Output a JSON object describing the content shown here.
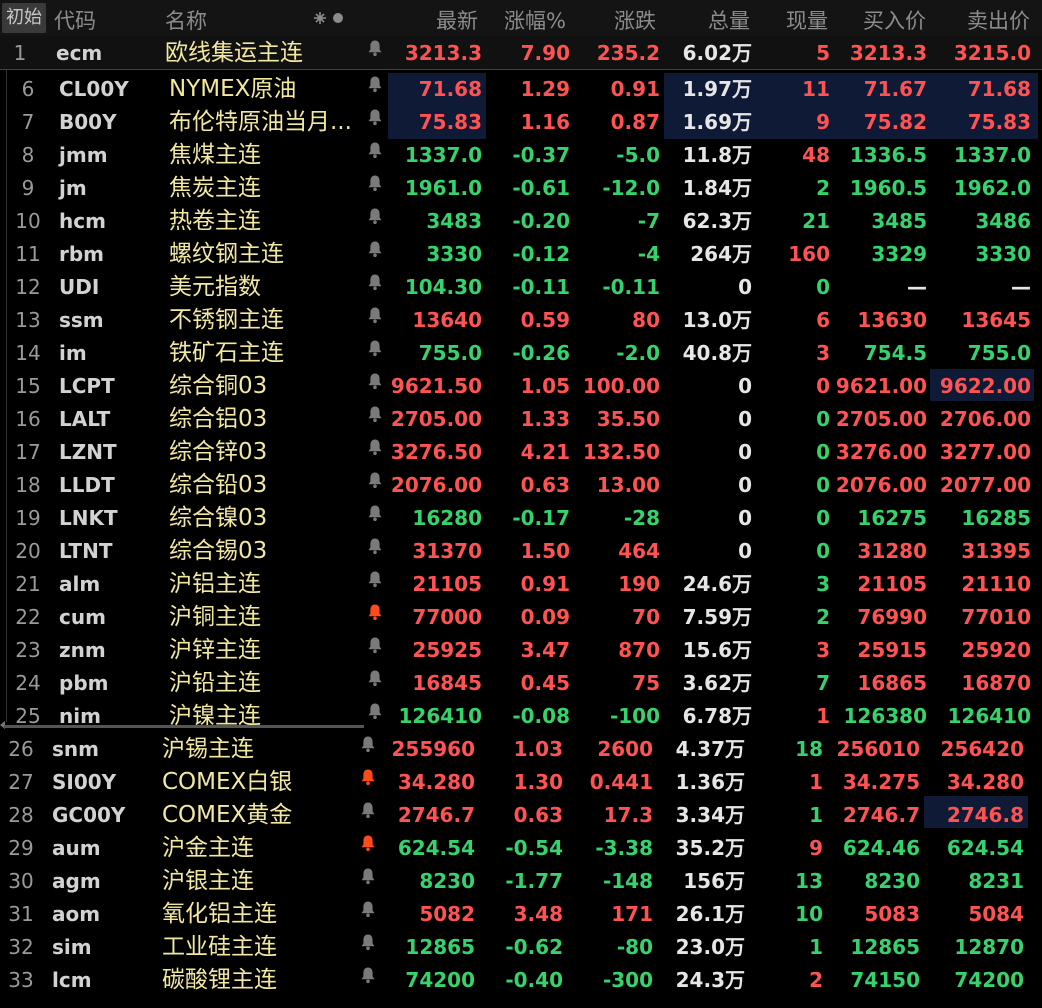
{
  "header": {
    "init_button": "初始",
    "cols": [
      "代码",
      "名称",
      "最新",
      "涨幅%",
      "涨跌",
      "总量",
      "现量",
      "买入价",
      "卖出价"
    ]
  },
  "colors": {
    "up": "#ff5353",
    "down": "#36d26c",
    "flat": "#e6e6e6",
    "name": "#f2e8a0"
  },
  "pinned": {
    "idx": "1",
    "code": "ecm",
    "name": "欧线集运主连",
    "last": "3213.3",
    "pct": "7.90",
    "chg": "235.2",
    "vol": "6.02万",
    "cur": "5",
    "bid": "3213.3",
    "ask": "3215.0",
    "dir": "up",
    "bell": "inactive"
  },
  "rows": [
    {
      "idx": "6",
      "code": "CL00Y",
      "name": "NYMEX原油",
      "last": "71.68",
      "pct": "1.29",
      "chg": "0.91",
      "vol": "1.97万",
      "cur": "11",
      "bid": "71.67",
      "ask": "71.68",
      "dir": "up",
      "curdir": "up",
      "bell": "inactive"
    },
    {
      "idx": "7",
      "code": "B00Y",
      "name": "布伦特原油当月...",
      "last": "75.83",
      "pct": "1.16",
      "chg": "0.87",
      "vol": "1.69万",
      "cur": "9",
      "bid": "75.82",
      "ask": "75.83",
      "dir": "up",
      "curdir": "up",
      "bell": "inactive"
    },
    {
      "idx": "8",
      "code": "jmm",
      "name": "焦煤主连",
      "last": "1337.0",
      "pct": "-0.37",
      "chg": "-5.0",
      "vol": "11.8万",
      "cur": "48",
      "bid": "1336.5",
      "ask": "1337.0",
      "dir": "down",
      "curdir": "up",
      "bell": "inactive"
    },
    {
      "idx": "9",
      "code": "jm",
      "name": "焦炭主连",
      "last": "1961.0",
      "pct": "-0.61",
      "chg": "-12.0",
      "vol": "1.84万",
      "cur": "2",
      "bid": "1960.5",
      "ask": "1962.0",
      "dir": "down",
      "curdir": "down",
      "bell": "inactive"
    },
    {
      "idx": "10",
      "code": "hcm",
      "name": "热卷主连",
      "last": "3483",
      "pct": "-0.20",
      "chg": "-7",
      "vol": "62.3万",
      "cur": "21",
      "bid": "3485",
      "ask": "3486",
      "dir": "down",
      "curdir": "down",
      "bell": "inactive"
    },
    {
      "idx": "11",
      "code": "rbm",
      "name": "螺纹钢主连",
      "last": "3330",
      "pct": "-0.12",
      "chg": "-4",
      "vol": "264万",
      "cur": "160",
      "bid": "3329",
      "ask": "3330",
      "dir": "down",
      "curdir": "up",
      "bell": "inactive"
    },
    {
      "idx": "12",
      "code": "UDI",
      "name": "美元指数",
      "last": "104.30",
      "pct": "-0.11",
      "chg": "-0.11",
      "vol": "0",
      "cur": "0",
      "bid": "—",
      "ask": "—",
      "dir": "down",
      "curdir": "down",
      "bidflat": true,
      "bell": "inactive"
    },
    {
      "idx": "13",
      "code": "ssm",
      "name": "不锈钢主连",
      "last": "13640",
      "pct": "0.59",
      "chg": "80",
      "vol": "13.0万",
      "cur": "6",
      "bid": "13630",
      "ask": "13645",
      "dir": "up",
      "curdir": "up",
      "bell": "inactive"
    },
    {
      "idx": "14",
      "code": "im",
      "name": "铁矿石主连",
      "last": "755.0",
      "pct": "-0.26",
      "chg": "-2.0",
      "vol": "40.8万",
      "cur": "3",
      "bid": "754.5",
      "ask": "755.0",
      "dir": "down",
      "curdir": "up",
      "bell": "inactive"
    },
    {
      "idx": "15",
      "code": "LCPT",
      "name": "综合铜03",
      "last": "9621.50",
      "pct": "1.05",
      "chg": "100.00",
      "vol": "0",
      "cur": "0",
      "bid": "9621.00",
      "ask": "9622.00",
      "dir": "up",
      "curdir": "up",
      "bell": "inactive"
    },
    {
      "idx": "16",
      "code": "LALT",
      "name": "综合铝03",
      "last": "2705.00",
      "pct": "1.33",
      "chg": "35.50",
      "vol": "0",
      "cur": "0",
      "bid": "2705.00",
      "ask": "2706.00",
      "dir": "up",
      "curdir": "down",
      "bell": "inactive"
    },
    {
      "idx": "17",
      "code": "LZNT",
      "name": "综合锌03",
      "last": "3276.50",
      "pct": "4.21",
      "chg": "132.50",
      "vol": "0",
      "cur": "0",
      "bid": "3276.00",
      "ask": "3277.00",
      "dir": "up",
      "curdir": "down",
      "bell": "inactive"
    },
    {
      "idx": "18",
      "code": "LLDT",
      "name": "综合铅03",
      "last": "2076.00",
      "pct": "0.63",
      "chg": "13.00",
      "vol": "0",
      "cur": "0",
      "bid": "2076.00",
      "ask": "2077.00",
      "dir": "up",
      "curdir": "down",
      "bell": "inactive"
    },
    {
      "idx": "19",
      "code": "LNKT",
      "name": "综合镍03",
      "last": "16280",
      "pct": "-0.17",
      "chg": "-28",
      "vol": "0",
      "cur": "0",
      "bid": "16275",
      "ask": "16285",
      "dir": "down",
      "curdir": "down",
      "bell": "inactive"
    },
    {
      "idx": "20",
      "code": "LTNT",
      "name": "综合锡03",
      "last": "31370",
      "pct": "1.50",
      "chg": "464",
      "vol": "0",
      "cur": "0",
      "bid": "31280",
      "ask": "31395",
      "dir": "up",
      "curdir": "down",
      "bell": "inactive"
    },
    {
      "idx": "21",
      "code": "alm",
      "name": "沪铝主连",
      "last": "21105",
      "pct": "0.91",
      "chg": "190",
      "vol": "24.6万",
      "cur": "3",
      "bid": "21105",
      "ask": "21110",
      "dir": "up",
      "curdir": "down",
      "bell": "inactive"
    },
    {
      "idx": "22",
      "code": "cum",
      "name": "沪铜主连",
      "last": "77000",
      "pct": "0.09",
      "chg": "70",
      "vol": "7.59万",
      "cur": "2",
      "bid": "76990",
      "ask": "77010",
      "dir": "up",
      "curdir": "down",
      "bell": "active"
    },
    {
      "idx": "23",
      "code": "znm",
      "name": "沪锌主连",
      "last": "25925",
      "pct": "3.47",
      "chg": "870",
      "vol": "15.6万",
      "cur": "3",
      "bid": "25915",
      "ask": "25920",
      "dir": "up",
      "curdir": "up",
      "bell": "inactive"
    },
    {
      "idx": "24",
      "code": "pbm",
      "name": "沪铅主连",
      "last": "16845",
      "pct": "0.45",
      "chg": "75",
      "vol": "3.62万",
      "cur": "7",
      "bid": "16865",
      "ask": "16870",
      "dir": "up",
      "curdir": "down",
      "bell": "inactive"
    },
    {
      "idx": "25",
      "code": "nim",
      "name": "沪镍主连",
      "last": "126410",
      "pct": "-0.08",
      "chg": "-100",
      "vol": "6.78万",
      "cur": "1",
      "bid": "126380",
      "ask": "126410",
      "dir": "down",
      "curdir": "up",
      "bell": "inactive"
    },
    {
      "idx": "26",
      "code": "snm",
      "name": "沪锡主连",
      "last": "255960",
      "pct": "1.03",
      "chg": "2600",
      "vol": "4.37万",
      "cur": "18",
      "bid": "256010",
      "ask": "256420",
      "dir": "up",
      "curdir": "down",
      "bell": "inactive",
      "shift": true
    },
    {
      "idx": "27",
      "code": "SI00Y",
      "name": "COMEX白银",
      "last": "34.280",
      "pct": "1.30",
      "chg": "0.441",
      "vol": "1.36万",
      "cur": "1",
      "bid": "34.275",
      "ask": "34.280",
      "dir": "up",
      "curdir": "up",
      "bell": "active",
      "shift": true
    },
    {
      "idx": "28",
      "code": "GC00Y",
      "name": "COMEX黄金",
      "last": "2746.7",
      "pct": "0.63",
      "chg": "17.3",
      "vol": "3.34万",
      "cur": "1",
      "bid": "2746.7",
      "ask": "2746.8",
      "dir": "up",
      "curdir": "down",
      "bell": "inactive",
      "shift": true
    },
    {
      "idx": "29",
      "code": "aum",
      "name": "沪金主连",
      "last": "624.54",
      "pct": "-0.54",
      "chg": "-3.38",
      "vol": "35.2万",
      "cur": "9",
      "bid": "624.46",
      "ask": "624.54",
      "dir": "down",
      "curdir": "up",
      "bell": "active",
      "shift": true
    },
    {
      "idx": "30",
      "code": "agm",
      "name": "沪银主连",
      "last": "8230",
      "pct": "-1.77",
      "chg": "-148",
      "vol": "156万",
      "cur": "13",
      "bid": "8230",
      "ask": "8231",
      "dir": "down",
      "curdir": "down",
      "bell": "inactive",
      "shift": true
    },
    {
      "idx": "31",
      "code": "aom",
      "name": "氧化铝主连",
      "last": "5082",
      "pct": "3.48",
      "chg": "171",
      "vol": "26.1万",
      "cur": "10",
      "bid": "5083",
      "ask": "5084",
      "dir": "up",
      "curdir": "down",
      "bell": "inactive",
      "shift": true
    },
    {
      "idx": "32",
      "code": "sim",
      "name": "工业硅主连",
      "last": "12865",
      "pct": "-0.62",
      "chg": "-80",
      "vol": "23.0万",
      "cur": "1",
      "bid": "12865",
      "ask": "12870",
      "dir": "down",
      "curdir": "down",
      "bell": "inactive",
      "shift": true
    },
    {
      "idx": "33",
      "code": "lcm",
      "name": "碳酸锂主连",
      "last": "74200",
      "pct": "-0.40",
      "chg": "-300",
      "vol": "24.3万",
      "cur": "2",
      "bid": "74150",
      "ask": "74200",
      "dir": "down",
      "curdir": "up",
      "bell": "inactive",
      "shift": true
    }
  ]
}
